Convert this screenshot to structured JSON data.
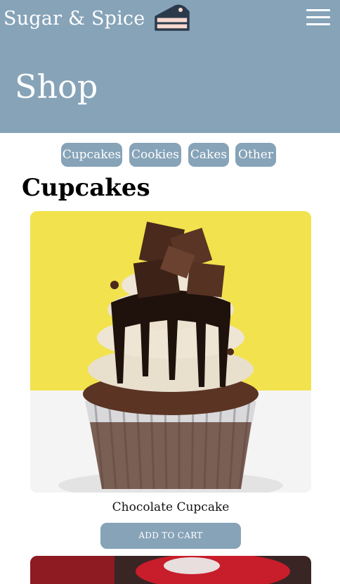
{
  "header": {
    "brand_name": "Sugar & Spice",
    "logo_icon": "cake-slice-icon",
    "menu_icon": "hamburger-menu-icon",
    "page_title": "Shop",
    "background_color": "#86a3b8"
  },
  "category_nav": {
    "items": [
      {
        "label": "Cupcakes"
      },
      {
        "label": "Cookies"
      },
      {
        "label": "Cakes"
      },
      {
        "label": "Other"
      }
    ]
  },
  "section": {
    "heading": "Cupcakes"
  },
  "products": [
    {
      "name": "Chocolate Cupcake",
      "image": "chocolate-cupcake-image",
      "cta_label": "ADD TO CART"
    },
    {
      "image": "red-cupcake-image"
    }
  ],
  "colors": {
    "accent": "#86a3b8",
    "text": "#000000",
    "background": "#ffffff"
  }
}
